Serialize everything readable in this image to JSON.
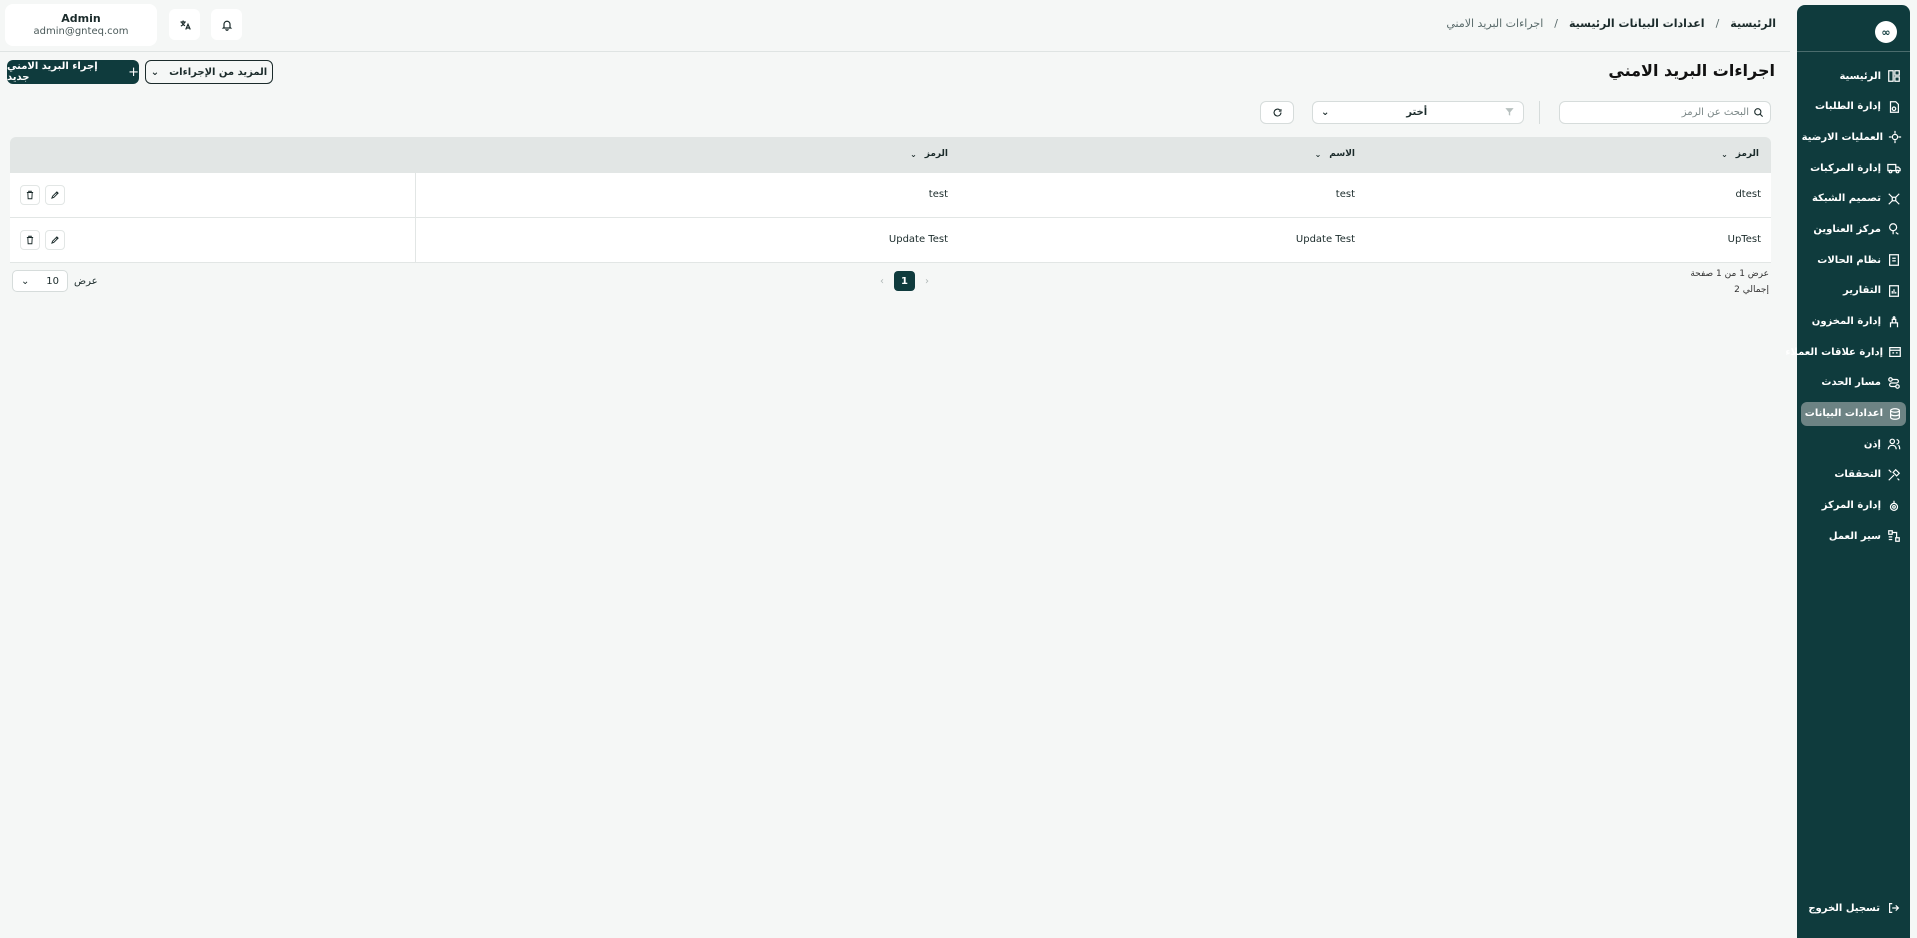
{
  "sidebar": {
    "logo": "∞",
    "items": [
      {
        "label": "الرئيسية",
        "icon": "layout-icon"
      },
      {
        "label": "إدارة الطلبات",
        "icon": "orders-icon"
      },
      {
        "label": "العمليات الارضية",
        "icon": "ground-ops-icon"
      },
      {
        "label": "إدارة المركبات",
        "icon": "truck-icon"
      },
      {
        "label": "تصميم الشبكة",
        "icon": "network-icon"
      },
      {
        "label": "مركز العناوين",
        "icon": "map-pin-icon"
      },
      {
        "label": "نظام الحالات",
        "icon": "status-icon"
      },
      {
        "label": "التقارير",
        "icon": "report-icon"
      },
      {
        "label": "إدارة المخزون",
        "icon": "inventory-icon"
      },
      {
        "label": "إدارة علاقات العملاء",
        "icon": "crm-icon"
      },
      {
        "label": "مسار الحدث",
        "icon": "route-icon"
      },
      {
        "label": "اعدادات البيانات",
        "icon": "database-icon"
      },
      {
        "label": "إذن",
        "icon": "users-icon"
      },
      {
        "label": "التحققات",
        "icon": "tools-icon"
      },
      {
        "label": "إدارة المركز",
        "icon": "center-icon"
      },
      {
        "label": "سير العمل",
        "icon": "workflow-icon"
      }
    ],
    "active_index": 11,
    "logout": "تسجيل الخروج"
  },
  "header": {
    "breadcrumb": [
      "الرئيسية",
      "اعدادات البيانات الرئيسية",
      "اجراءات البريد الامني"
    ],
    "user_name": "Admin",
    "user_email": "admin@gnteq.com"
  },
  "page": {
    "title": "اجراءات البريد الامني",
    "new_button": "إجراء البريد الامني جديد",
    "more_button": "المزيد من الإجراءات"
  },
  "filters": {
    "search_placeholder": "البحث عن الرمز",
    "select_value": "أختر"
  },
  "table": {
    "columns": [
      "الرمز",
      "الاسم",
      "الرمز"
    ],
    "rows": [
      [
        "dtest",
        "test",
        "test"
      ],
      [
        "UpTest",
        "Update Test",
        "Update Test"
      ]
    ]
  },
  "footer": {
    "page_info": "عرض 1 من 1 صفحة",
    "total": "إجمالي 2",
    "current_page": "1",
    "page_size": "10",
    "page_size_label": "عرض"
  },
  "colors": {
    "primary": "#0f3b3d",
    "active_item": "#6d8384",
    "background": "#f5f7f6"
  }
}
